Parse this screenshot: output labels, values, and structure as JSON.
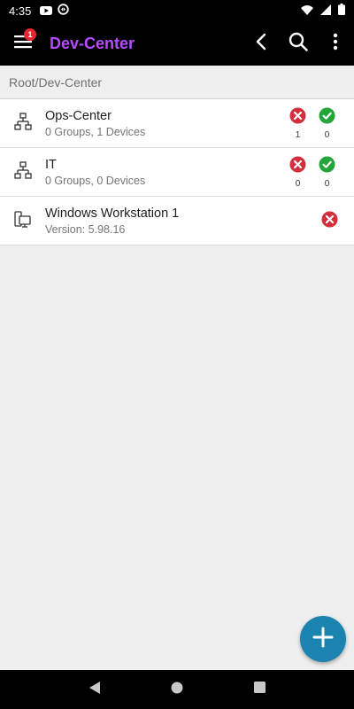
{
  "status_bar": {
    "time": "4:35",
    "left_icons": [
      "youtube-icon",
      "sync-icon"
    ],
    "right_icons": [
      "wifi-icon",
      "signal-icon",
      "battery-icon"
    ]
  },
  "app_bar": {
    "title": "Dev-Center",
    "title_color": "#b54cff",
    "menu_badge": "1",
    "badge_color": "#e8262e"
  },
  "breadcrumb": "Root/Dev-Center",
  "items": [
    {
      "type": "group",
      "icon": "network-tree-icon",
      "title": "Ops-Center",
      "subtitle": "0 Groups, 1 Devices",
      "error_count": "1",
      "ok_count": "0"
    },
    {
      "type": "group",
      "icon": "network-tree-icon",
      "title": "IT",
      "subtitle": "0 Groups, 0 Devices",
      "error_count": "0",
      "ok_count": "0"
    },
    {
      "type": "device",
      "icon": "workstation-icon",
      "title": "Windows Workstation 1",
      "subtitle": "Version: 5.98.16",
      "status": "error"
    }
  ],
  "colors": {
    "error": "#d32f3c",
    "ok": "#22a63a",
    "fab": "#1a83b0"
  }
}
